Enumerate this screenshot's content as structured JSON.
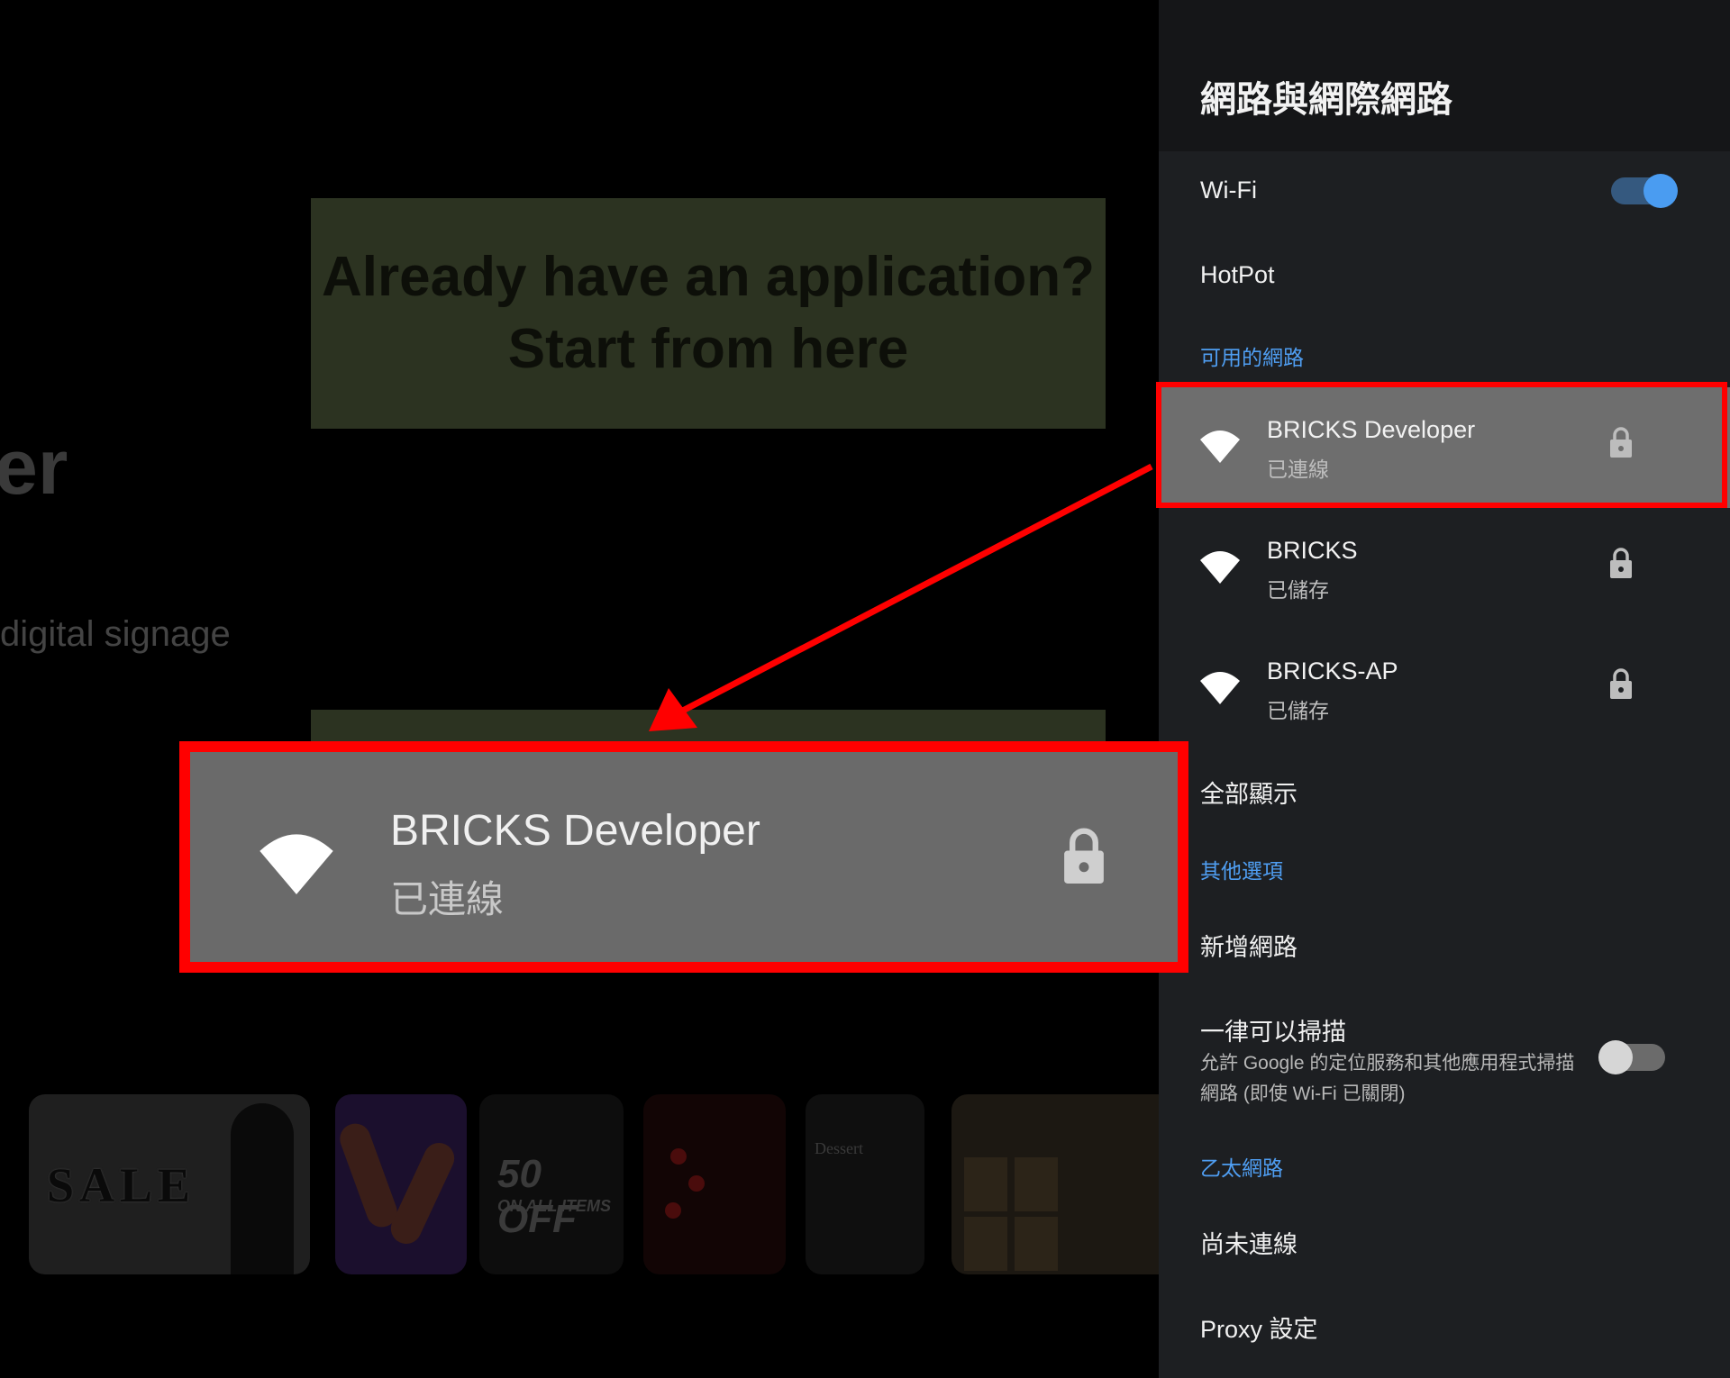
{
  "background": {
    "cta_line1": "Already have an application?",
    "cta_line2": "Start from here",
    "title_fragment": "er",
    "subtitle_fragment": "digital signage",
    "thumbs": {
      "sale_text": "SALE",
      "offer_big": "50 OFF",
      "offer_small": "ON ALL ITEMS",
      "dessert_text": "Dessert"
    }
  },
  "panel": {
    "title": "網路與網際網路",
    "wifi_label": "Wi-Fi",
    "wifi_enabled": true,
    "hotspot_label": "HotPot",
    "available_section": "可用的網路",
    "networks": [
      {
        "name": "BRICKS Developer",
        "status": "已連線",
        "secured": true,
        "selected": true
      },
      {
        "name": "BRICKS",
        "status": "已儲存",
        "secured": true,
        "selected": false
      },
      {
        "name": "BRICKS-AP",
        "status": "已儲存",
        "secured": true,
        "selected": false
      }
    ],
    "show_all": "全部顯示",
    "other_section": "其他選項",
    "add_network": "新增網路",
    "scan_always_label": "一律可以掃描",
    "scan_always_desc": "允許 Google 的定位服務和其他應用程式掃描網路 (即使 Wi-Fi 已關閉)",
    "scan_always_enabled": false,
    "ethernet_section": "乙太網路",
    "ethernet_status": "尚未連線",
    "proxy_label": "Proxy 設定"
  },
  "callout": {
    "name": "BRICKS Developer",
    "status": "已連線"
  },
  "colors": {
    "highlight": "#ff0000",
    "accent": "#4f9ef2",
    "selected_row": "#6e6e6e"
  }
}
